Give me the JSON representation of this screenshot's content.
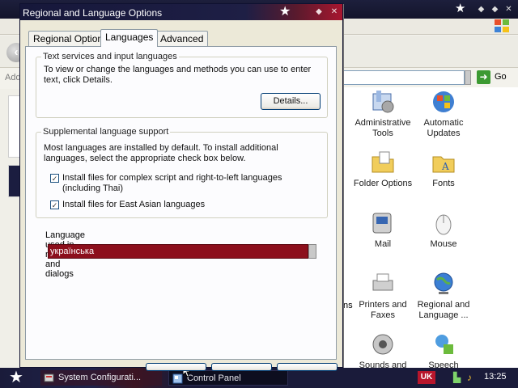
{
  "dialog": {
    "title": "Regional and Language Options",
    "tabs": [
      {
        "label": "Regional Options"
      },
      {
        "label": "Languages"
      },
      {
        "label": "Advanced"
      }
    ],
    "text_services": {
      "legend": "Text services and input languages",
      "description": "To view or change the languages and methods you can use to enter text, click Details.",
      "details_button": "Details..."
    },
    "supplemental": {
      "legend": "Supplemental language support",
      "description": "Most languages are installed by default. To install additional languages, select the appropriate check box below.",
      "options": [
        {
          "label": "Install files for complex script and right-to-left languages (including Thai)",
          "checked": true
        },
        {
          "label": "Install files for East Asian languages",
          "checked": true
        }
      ]
    },
    "menu_language": {
      "label": "Language used in menus and dialogs",
      "selected": "українська"
    }
  },
  "background_window": {
    "address_label": "Add",
    "go_label": "Go",
    "partial_label": "ns",
    "items": [
      {
        "label": "Administrative Tools",
        "icon": "admin-tools-icon"
      },
      {
        "label": "Automatic Updates",
        "icon": "automatic-updates-icon"
      },
      {
        "label": "Folder Options",
        "icon": "folder-options-icon"
      },
      {
        "label": "Fonts",
        "icon": "fonts-icon"
      },
      {
        "label": "Mail",
        "icon": "mail-icon"
      },
      {
        "label": "Mouse",
        "icon": "mouse-icon"
      },
      {
        "label": "Printers and Faxes",
        "icon": "printers-icon"
      },
      {
        "label": "Regional and Language ...",
        "icon": "regional-icon"
      },
      {
        "label": "Sounds and",
        "icon": "sounds-icon"
      },
      {
        "label": "Speech",
        "icon": "speech-icon"
      }
    ]
  },
  "taskbar": {
    "tasks": [
      {
        "label": "System Configurati..."
      },
      {
        "label": "Control Panel"
      }
    ],
    "language_indicator": "UK",
    "clock": "13:25"
  },
  "colors": {
    "title_dark": "#16173a",
    "title_red": "#a8162f",
    "selected_language_bg": "#8c0f1c"
  }
}
